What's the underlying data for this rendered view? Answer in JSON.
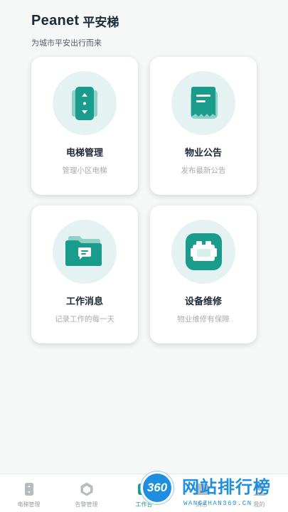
{
  "header": {
    "brand_en": "Peanet",
    "brand_cn": "平安梯",
    "tagline": "为城市平安出行而来"
  },
  "cards": [
    {
      "title": "电梯管理",
      "subtitle": "管理小区电梯",
      "icon": "elevator-icon"
    },
    {
      "title": "物业公告",
      "subtitle": "发布最新公告",
      "icon": "announcement-icon"
    },
    {
      "title": "工作消息",
      "subtitle": "记录工作的每一天",
      "icon": "message-folder-icon"
    },
    {
      "title": "设备维修",
      "subtitle": "物业维修有保障",
      "icon": "device-repair-icon"
    }
  ],
  "tabbar": {
    "items": [
      {
        "label": "电梯管理",
        "icon": "elevator-icon"
      },
      {
        "label": "告警管理",
        "icon": "alarm-icon"
      },
      {
        "label": "工作台",
        "icon": "workbench-icon"
      },
      {
        "label": "消息",
        "icon": "message-icon"
      },
      {
        "label": "我的",
        "icon": "user-icon"
      }
    ],
    "active_index": 2
  },
  "watermark": {
    "badge": "360",
    "title": "网站排行榜",
    "url": "WANGZHAN360.CN"
  },
  "colors": {
    "accent": "#1a9c8c",
    "icon_bg": "#e4f3f1",
    "text_dark": "#1d2a35",
    "text_muted": "#a6acb0"
  }
}
